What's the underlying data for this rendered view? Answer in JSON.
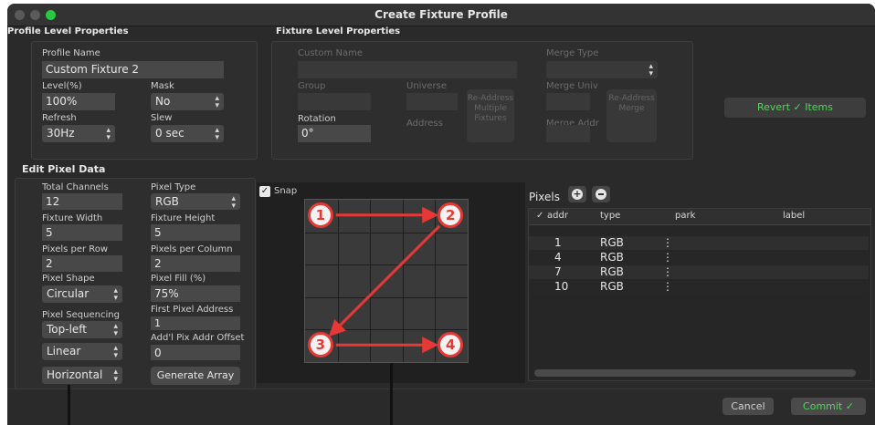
{
  "window": {
    "title": "Create Fixture Profile"
  },
  "profile_level": {
    "section_title": "Profile Level Properties",
    "profile_name_label": "Profile Name",
    "profile_name_value": "Custom Fixture 2",
    "level_label": "Level(%)",
    "level_value": "100%",
    "mask_label": "Mask",
    "mask_value": "No",
    "refresh_label": "Refresh",
    "refresh_value": "30Hz",
    "slew_label": "Slew",
    "slew_value": "0 sec"
  },
  "fixture_level": {
    "section_title": "Fixture Level Properties",
    "custom_name_label": "Custom Name",
    "custom_name_value": "",
    "merge_type_label": "Merge Type",
    "group_label": "Group",
    "universe_label": "Universe",
    "merge_univ_label": "Merge Univ",
    "readdress_multiple_label": "Re-Address Multiple Fixtures",
    "readdress_merge_label": "Re-Address Merge",
    "rotation_label": "Rotation",
    "rotation_value": "0°",
    "address_label": "Address",
    "merge_addr_label": "Merge Addr",
    "revert_label": "Revert ✓ Items"
  },
  "pixel_data": {
    "section_title": "Edit Pixel Data",
    "total_channels_label": "Total Channels",
    "total_channels_value": "12",
    "pixel_type_label": "Pixel Type",
    "pixel_type_value": "RGB",
    "fixture_width_label": "Fixture Width",
    "fixture_width_value": "5",
    "fixture_height_label": "Fixture Height",
    "fixture_height_value": "5",
    "pixels_per_row_label": "Pixels per Row",
    "pixels_per_row_value": "2",
    "pixels_per_column_label": "Pixels per Column",
    "pixels_per_column_value": "2",
    "pixel_shape_label": "Pixel Shape",
    "pixel_shape_value": "Circular",
    "pixel_fill_label": "Pixel Fill (%)",
    "pixel_fill_value": "75%",
    "pixel_sequencing_label": "Pixel Sequencing",
    "pixel_sequencing_value": "Top-left",
    "first_pixel_address_label": "First Pixel Address",
    "first_pixel_address_value": "1",
    "sequencing_mode_value": "Linear",
    "addl_offset_label": "Add'l Pix Addr Offset",
    "addl_offset_value": "0",
    "direction_value": "Horizontal",
    "generate_label": "Generate Array",
    "snap_label": "Snap",
    "snap_checked": true
  },
  "preview": {
    "grid_columns": 5,
    "grid_rows": 5,
    "pixels": [
      {
        "label": "1",
        "col": 0,
        "row": 0
      },
      {
        "label": "2",
        "col": 4,
        "row": 0
      },
      {
        "label": "3",
        "col": 0,
        "row": 4
      },
      {
        "label": "4",
        "col": 4,
        "row": 4
      }
    ],
    "arrow_color": "#e53935"
  },
  "pixels_table": {
    "title": "Pixels",
    "columns": [
      "✓",
      "addr",
      "type",
      "park",
      "label"
    ],
    "rows": [
      {
        "addr": "1",
        "type": "RGB",
        "park": "",
        "label": ""
      },
      {
        "addr": "4",
        "type": "RGB",
        "park": "",
        "label": ""
      },
      {
        "addr": "7",
        "type": "RGB",
        "park": "",
        "label": ""
      },
      {
        "addr": "10",
        "type": "RGB",
        "park": "",
        "label": ""
      }
    ]
  },
  "footer": {
    "cancel_label": "Cancel",
    "commit_label": "Commit ✓"
  },
  "icons": {
    "add": "plus-circle-icon",
    "remove": "minus-circle-icon",
    "select_arrows": "up-down-chevron-icon"
  },
  "colors": {
    "accent_green": "#53d65a",
    "annotation_red": "#e53935",
    "window_bg": "#2a2a2a"
  }
}
